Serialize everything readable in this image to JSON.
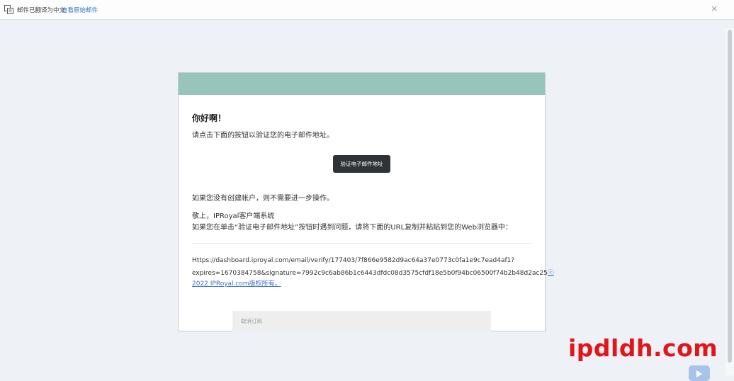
{
  "topbar": {
    "notice": "邮件已翻译为中文",
    "view_original": "查看原始邮件",
    "close_glyph": "×"
  },
  "email": {
    "greeting": "你好啊！",
    "instruction": "请点击下面的按钮以验证您的电子邮件地址。",
    "verify_button": "验证电子邮件地址",
    "no_account": "如果您没有创建帐户，则不需要进一步操作。",
    "regards": "敬上，IPRoyal客户端系统",
    "trouble": "如果您在单击“验证电子邮件地址”按钮时遇到问题，请将下面的URL复制并粘贴到您的Web浏览器中：",
    "url_line1": "Https://dashboard.iproyal.com/email/verify/177403/7f866e9582d9ac64a37e0773c0fa1e9c7ead4af1?",
    "url_line2": "expires=1670384758&signature=7992c9c6ab86b1c6443dfdc08d3575cfdf18e5b0f94bc06500f74b2b48d2ac25",
    "url_line2_tail": "ⓒ",
    "copyright": "2022 IPRoyal.com版权所有。",
    "unsubscribe": "取消订阅"
  },
  "watermark": "ipdldh.com",
  "colors": {
    "header": "#97c4bb",
    "button": "#2f3337",
    "link": "#3b73c9",
    "watermark": "#e3151a"
  },
  "icons": {
    "translate": "translate-icon",
    "close": "close-icon",
    "fab": "play-icon"
  }
}
